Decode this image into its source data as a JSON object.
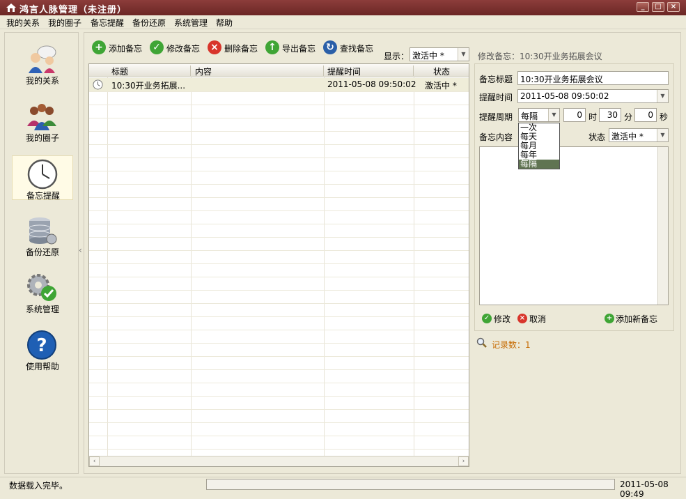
{
  "window": {
    "title": "鸿言人脉管理（未注册）",
    "min": "_",
    "max": "□",
    "close": "×"
  },
  "menu": [
    "我的关系",
    "我的圈子",
    "备忘提醒",
    "备份还原",
    "系统管理",
    "帮助"
  ],
  "sidebar": {
    "items": [
      {
        "label": "我的关系",
        "icon": "contacts-people-icon"
      },
      {
        "label": "我的圈子",
        "icon": "group-people-icon"
      },
      {
        "label": "备忘提醒",
        "icon": "clock-icon"
      },
      {
        "label": "备份还原",
        "icon": "database-icon"
      },
      {
        "label": "系统管理",
        "icon": "gear-check-icon"
      },
      {
        "label": "使用帮助",
        "icon": "help-icon"
      }
    ],
    "active": "备忘提醒"
  },
  "toolbar": {
    "add": "添加备忘",
    "edit": "修改备忘",
    "delete": "删除备忘",
    "export": "导出备忘",
    "find": "查找备忘",
    "show_label": "显示：",
    "show_value": "激活中 *"
  },
  "grid": {
    "columns": [
      "标题",
      "内容",
      "提醒时间",
      "状态"
    ],
    "rows": [
      {
        "title": "10:30开业务拓展...",
        "content": "",
        "time": "2011-05-08 09:50:02",
        "status": "激活中 *"
      }
    ]
  },
  "panel": {
    "title": "修改备忘：10:30开业务拓展会议",
    "memo_title_label": "备忘标题",
    "memo_title_value": "10:30开业务拓展会议",
    "remind_time_label": "提醒时间",
    "remind_time_value": "2011-05-08 09:50:02",
    "period_label": "提醒周期",
    "period_value": "每隔",
    "hours": "0",
    "hours_unit": "时",
    "minutes": "30",
    "minutes_unit": "分",
    "seconds": "0",
    "seconds_unit": "秒",
    "period_options": [
      "一次",
      "每天",
      "每月",
      "每年",
      "每隔"
    ],
    "content_label": "备忘内容",
    "status_label": "状态",
    "status_value": "激活中 *",
    "content_value": "",
    "save": "修改",
    "cancel": "取消",
    "add_new": "添加新备忘",
    "record_label": "记录数：1"
  },
  "status": {
    "message": "数据载入完毕。",
    "time": "2011-05-08 09:49"
  },
  "colors": {
    "titlebar": "#7a302e",
    "selected_row": "#efedd9",
    "accent_green": "#3fa535",
    "accent_red": "#d8352b",
    "accent_blue": "#2a5fa8"
  }
}
